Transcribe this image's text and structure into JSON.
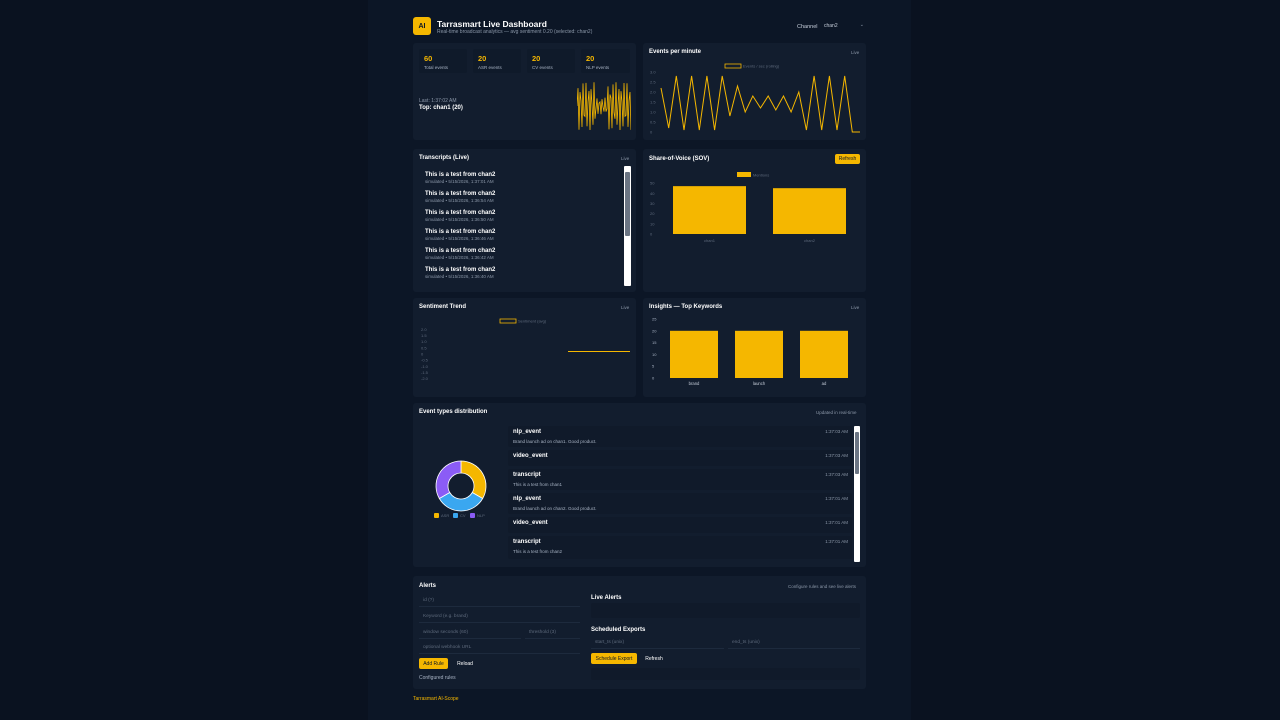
{
  "header": {
    "logo": "AI",
    "title": "Tarrasmart Live Dashboard",
    "subtitle": "Real-time broadcast analytics — avg sentiment 0.20 (selected: chan2)",
    "channel_label": "Channel",
    "channel_value": "chan2"
  },
  "stats": {
    "items": [
      {
        "value": "60",
        "label": "Total events"
      },
      {
        "value": "20",
        "label": "ASR events"
      },
      {
        "value": "20",
        "label": "CV events"
      },
      {
        "value": "20",
        "label": "NLP events"
      }
    ],
    "last": "Last: 1:37:02 AM",
    "top": "Top: chan1 (20)"
  },
  "events_per_minute": {
    "title": "Events per minute",
    "badge": "Live",
    "legend": "Events / sec (rolling)"
  },
  "transcripts": {
    "title": "Transcripts (Live)",
    "badge": "Live",
    "items": [
      {
        "text": "This is a test from chan2",
        "meta": "simulated • 5/15/2026, 1:37:01 AM"
      },
      {
        "text": "This is a test from chan2",
        "meta": "simulated • 5/15/2026, 1:36:54 AM"
      },
      {
        "text": "This is a test from chan2",
        "meta": "simulated • 5/15/2026, 1:36:50 AM"
      },
      {
        "text": "This is a test from chan2",
        "meta": "simulated • 5/15/2026, 1:36:46 AM"
      },
      {
        "text": "This is a test from chan2",
        "meta": "simulated • 5/15/2026, 1:36:42 AM"
      },
      {
        "text": "This is a test from chan2",
        "meta": "simulated • 5/15/2026, 1:36:40 AM"
      }
    ]
  },
  "sov": {
    "title": "Share-of-Voice (SOV)",
    "refresh_label": "Refresh",
    "legend": "Mentions"
  },
  "sentiment": {
    "title": "Sentiment Trend",
    "badge": "Live",
    "legend": "Sentiment (avg)"
  },
  "insights": {
    "title": "Insights — Top Keywords",
    "badge": "Live"
  },
  "event_types": {
    "title": "Event types distribution",
    "badge": "Updated in real-time",
    "legend": [
      "ASR",
      "CV",
      "NLP"
    ],
    "events": [
      {
        "type": "nlp_event",
        "time": "1:37:03 AM",
        "text": "Brand launch ad on chan1. Good product."
      },
      {
        "type": "video_event",
        "time": "1:37:03 AM",
        "text": ""
      },
      {
        "type": "transcript",
        "time": "1:37:03 AM",
        "text": "This is a test from chan1"
      },
      {
        "type": "nlp_event",
        "time": "1:37:01 AM",
        "text": "Brand launch ad on chan2. Good product."
      },
      {
        "type": "video_event",
        "time": "1:37:01 AM",
        "text": ""
      },
      {
        "type": "transcript",
        "time": "1:37:01 AM",
        "text": "This is a test from chan2"
      }
    ]
  },
  "alerts": {
    "title": "Alerts",
    "badge": "Configure rules and see live alerts",
    "id_placeholder": "id (?)",
    "keyword_placeholder": "Keyword (e.g. brand)",
    "window_placeholder": "window seconds (60)",
    "threshold_placeholder": "threshold (3)",
    "webhook_placeholder": "optional webhook URL",
    "add_rule_label": "Add Rule",
    "reload_label": "Reload",
    "configured_label": "Configured rules",
    "live_alerts_title": "Live Alerts",
    "scheduled_title": "Scheduled Exports",
    "start_placeholder": "start_ts (unix)",
    "end_placeholder": "end_ts (unix)",
    "schedule_label": "Schedule Export",
    "refresh_label": "Refresh"
  },
  "footer": "Tarrasmart AI-Scope",
  "colors": {
    "accent": "#f5b700",
    "cv": "#3aa7f0",
    "nlp": "#8b5cf6"
  },
  "chart_data": [
    {
      "type": "line",
      "title": "Events per minute",
      "series": [
        {
          "name": "Events / sec (rolling)",
          "values": [
            2.2,
            0.2,
            2.8,
            0.1,
            2.8,
            0.1,
            2.8,
            0.1,
            2.8,
            0.8,
            2.3,
            1.0,
            1.8,
            1.2,
            1.8,
            1.1,
            1.8,
            1.0,
            2.0,
            0.1,
            2.8,
            0.1,
            2.8,
            0.1,
            2.8,
            0.0,
            0.0
          ]
        }
      ],
      "yticks": [
        "3.0",
        "2.5",
        "2.0",
        "1.5",
        "1.0",
        "0.5",
        "0"
      ],
      "ylim": [
        0,
        3
      ]
    },
    {
      "type": "bar",
      "title": "Share-of-Voice (SOV)",
      "categories": [
        "chan1",
        "chan2"
      ],
      "series": [
        {
          "name": "Mentions",
          "values": [
            47,
            45
          ]
        }
      ],
      "yticks": [
        "50",
        "40",
        "30",
        "20",
        "10",
        "0"
      ],
      "ylim": [
        0,
        55
      ]
    },
    {
      "type": "line",
      "title": "Sentiment Trend",
      "series": [
        {
          "name": "Sentiment (avg)",
          "values": [
            0.2,
            0.2
          ]
        }
      ],
      "yticks": [
        "2.0",
        "1.5",
        "1.0",
        "0.5",
        "0",
        "-0.5",
        "-1.0",
        "-1.5",
        "-2.0"
      ],
      "ylim": [
        -2.2,
        2.2
      ]
    },
    {
      "type": "bar",
      "title": "Insights — Top Keywords",
      "categories": [
        "brand",
        "launch",
        "ad"
      ],
      "values": [
        20,
        20,
        20
      ],
      "yticks": [
        "25",
        "20",
        "15",
        "10",
        "5",
        "0"
      ],
      "ylim": [
        0,
        25
      ]
    },
    {
      "type": "pie",
      "title": "Event types distribution",
      "categories": [
        "ASR",
        "CV",
        "NLP"
      ],
      "values": [
        20,
        20,
        20
      ]
    }
  ]
}
